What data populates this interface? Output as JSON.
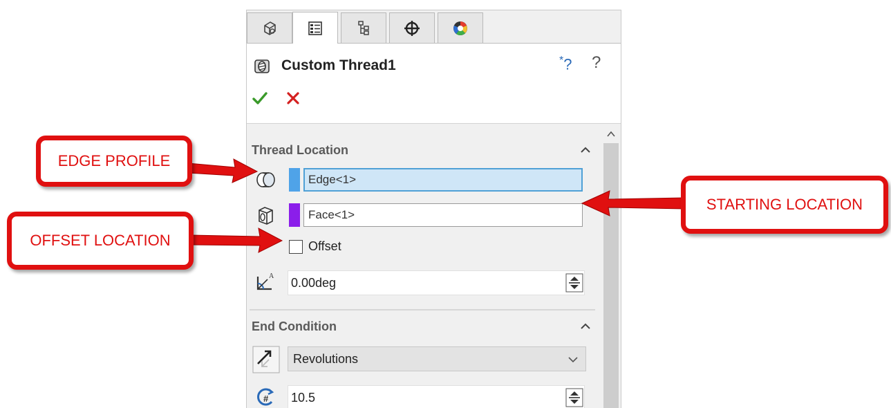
{
  "panel": {
    "tabs": [
      {
        "icon": "feature-manager-icon"
      },
      {
        "icon": "property-manager-icon",
        "active": true
      },
      {
        "icon": "configuration-manager-icon"
      },
      {
        "icon": "dimxpert-manager-icon"
      },
      {
        "icon": "display-manager-icon"
      }
    ],
    "title": "Custom Thread1",
    "feature_icon": "thread-feature-icon",
    "help_whats_wrong": "?",
    "help_whats_wrong_star": "*",
    "help_question": "?",
    "ok_icon": "checkmark-icon",
    "cancel_icon": "close-icon"
  },
  "thread_location": {
    "title": "Thread Location",
    "edge_selection": {
      "value": "Edge<1>",
      "color": "#4fa3e8"
    },
    "face_selection": {
      "value": "Face<1>",
      "color": "#8b1eea"
    },
    "offset_label": "Offset",
    "offset_checked": false,
    "angle_value": "0.00deg"
  },
  "end_condition": {
    "title": "End Condition",
    "type_value": "Revolutions",
    "revolutions_value": "10.5"
  },
  "callouts": {
    "edge_profile": "EDGE PROFILE",
    "starting_location": "STARTING LOCATION",
    "offset_location": "OFFSET LOCATION",
    "color": "#e01010"
  }
}
